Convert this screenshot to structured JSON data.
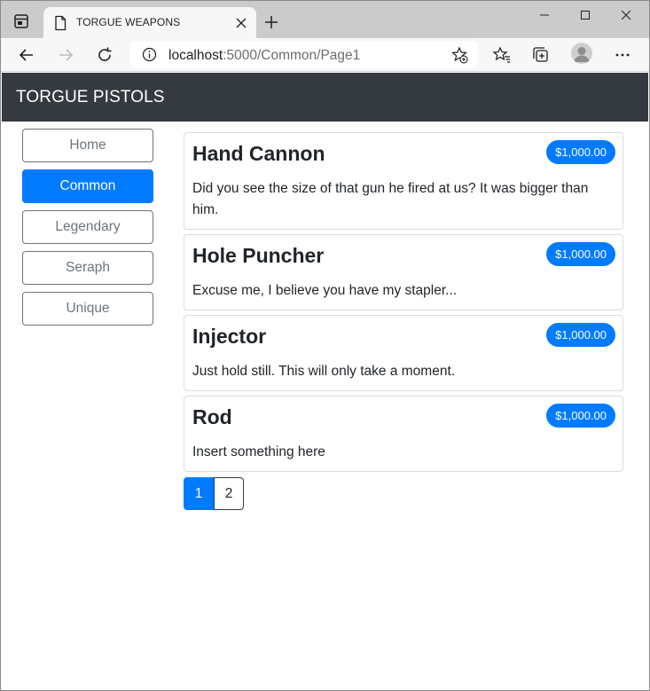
{
  "browser": {
    "tab_title": "TORGUE WEAPONS",
    "url_host": "localhost",
    "url_path": ":5000/Common/Page1"
  },
  "site": {
    "brand": "TORGUE PISTOLS",
    "nav": [
      {
        "label": "Home",
        "active": false
      },
      {
        "label": "Common",
        "active": true
      },
      {
        "label": "Legendary",
        "active": false
      },
      {
        "label": "Seraph",
        "active": false
      },
      {
        "label": "Unique",
        "active": false
      }
    ],
    "products": [
      {
        "name": "Hand Cannon",
        "price": "$1,000.00",
        "description": "Did you see the size of that gun he fired at us? It was bigger than him."
      },
      {
        "name": "Hole Puncher",
        "price": "$1,000.00",
        "description": "Excuse me, I believe you have my stapler..."
      },
      {
        "name": "Injector",
        "price": "$1,000.00",
        "description": "Just hold still. This will only take a moment."
      },
      {
        "name": "Rod",
        "price": "$1,000.00",
        "description": "Insert something here"
      }
    ],
    "pages": [
      "1",
      "2"
    ]
  }
}
